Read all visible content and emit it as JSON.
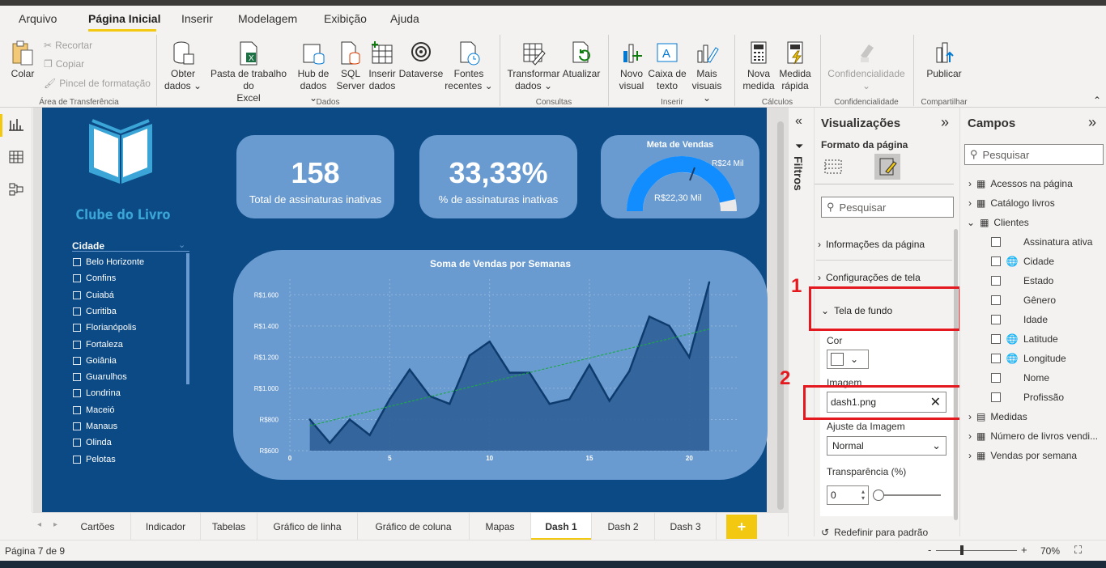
{
  "menu": {
    "items": [
      "Arquivo",
      "Página Inicial",
      "Inserir",
      "Modelagem",
      "Exibição",
      "Ajuda"
    ],
    "active": "Página Inicial"
  },
  "ribbon": {
    "colar": "Colar",
    "recortar": "Recortar",
    "copiar": "Copiar",
    "pincel": "Pincel de formatação",
    "grp_transfer": "Área de Transferência",
    "obter_dados": [
      "Obter",
      "dados ⌄"
    ],
    "pasta_excel": [
      "Pasta de trabalho do",
      "Excel"
    ],
    "hub": [
      "Hub de",
      "dados ⌄"
    ],
    "sql": [
      "SQL",
      "Server"
    ],
    "inserir_dados": [
      "Inserir",
      "dados"
    ],
    "dataverse": "Dataverse",
    "fontes": [
      "Fontes",
      "recentes ⌄"
    ],
    "grp_dados": "Dados",
    "transformar": [
      "Transformar",
      "dados ⌄"
    ],
    "atualizar": "Atualizar",
    "grp_consultas": "Consultas",
    "novo_visual": [
      "Novo",
      "visual"
    ],
    "caixa_texto": [
      "Caixa de",
      "texto"
    ],
    "mais_visuais": [
      "Mais",
      "visuais ⌄"
    ],
    "grp_inserir": "Inserir",
    "nova_medida": [
      "Nova",
      "medida"
    ],
    "medida_rapida": [
      "Medida",
      "rápida"
    ],
    "grp_calculos": "Cálculos",
    "confidencialidade": "Confidencialidade",
    "grp_conf": "Confidencialidade",
    "publicar": "Publicar",
    "grp_compartilhar": "Compartilhar"
  },
  "report": {
    "logo_text": "Clube do Livro",
    "kpi1": {
      "value": "158",
      "label": "Total de assinaturas inativas"
    },
    "kpi2": {
      "value": "33,33%",
      "label": "% de assinaturas inativas"
    },
    "gauge": {
      "title": "Meta de Vendas",
      "target_label": "R$24 Mil",
      "value_label": "R$22,30 Mil",
      "fill_fraction": 0.93
    },
    "slicer": {
      "title": "Cidade",
      "cities": [
        "Belo Horizonte",
        "Confins",
        "Cuiabá",
        "Curitiba",
        "Florianópolis",
        "Fortaleza",
        "Goiânia",
        "Guarulhos",
        "Londrina",
        "Maceió",
        "Manaus",
        "Olinda",
        "Pelotas"
      ]
    }
  },
  "chart_data": {
    "type": "area",
    "title": "Soma de Vendas por Semanas",
    "x": [
      1,
      2,
      3,
      4,
      5,
      6,
      7,
      8,
      9,
      10,
      11,
      12,
      13,
      14,
      15,
      16,
      17,
      18,
      19,
      20,
      21
    ],
    "values": [
      800,
      650,
      800,
      700,
      930,
      1120,
      950,
      900,
      1210,
      1300,
      1100,
      1100,
      900,
      930,
      1150,
      920,
      1110,
      1460,
      1400,
      1200,
      1680
    ],
    "trendline": [
      760,
      1380
    ],
    "xticks": [
      "0",
      "5",
      "10",
      "15",
      "20"
    ],
    "xtick_values": [
      0,
      5,
      10,
      15,
      20
    ],
    "yticks": [
      "R$600",
      "R$800",
      "R$1.000",
      "R$1.200",
      "R$1.400",
      "R$1.600"
    ],
    "ytick_values": [
      600,
      800,
      1000,
      1200,
      1400,
      1600
    ],
    "xlim": [
      0,
      22.5
    ],
    "ylim": [
      600,
      1700
    ],
    "xlabel": "",
    "ylabel": "",
    "colors": {
      "area": "#2f5f96",
      "line": "#0d3b6e",
      "trend": "#1fa84a"
    }
  },
  "filters": {
    "label": "Filtros"
  },
  "viz": {
    "title": "Visualizações",
    "subtitle": "Formato da página",
    "search_placeholder": "Pesquisar",
    "sec_info": "Informações da página",
    "sec_config": "Configurações de tela",
    "sec_fundo": "Tela de fundo",
    "cor_label": "Cor",
    "imagem_label": "Imagem",
    "imagem_value": "dash1.png",
    "ajuste_label": "Ajuste da Imagem",
    "ajuste_value": "Normal",
    "transp_label": "Transparência (%)",
    "transp_value": "0",
    "reset": "Redefinir para padrão"
  },
  "annotations": {
    "n1": "1",
    "n2": "2"
  },
  "fields": {
    "title": "Campos",
    "search_placeholder": "Pesquisar",
    "tables": {
      "acessos": "Acessos na página",
      "catalogo": "Catálogo livros",
      "clientes": "Clientes",
      "medidas": "Medidas",
      "numero": "Número de livros vendi...",
      "vendas": "Vendas por semana"
    },
    "clientes_fields": [
      "Assinatura ativa",
      "Cidade",
      "Estado",
      "Gênero",
      "Idade",
      "Latitude",
      "Longitude",
      "Nome",
      "Profissão"
    ]
  },
  "tabs": {
    "items": [
      "Cartões",
      "Indicador",
      "Tabelas",
      "Gráfico de linha",
      "Gráfico de coluna",
      "Mapas",
      "Dash 1",
      "Dash 2",
      "Dash 3"
    ],
    "active": "Dash 1",
    "add": "+"
  },
  "status": {
    "page": "Página 7 de 9",
    "zoom": "70%",
    "minus": "-",
    "plus": "+"
  }
}
